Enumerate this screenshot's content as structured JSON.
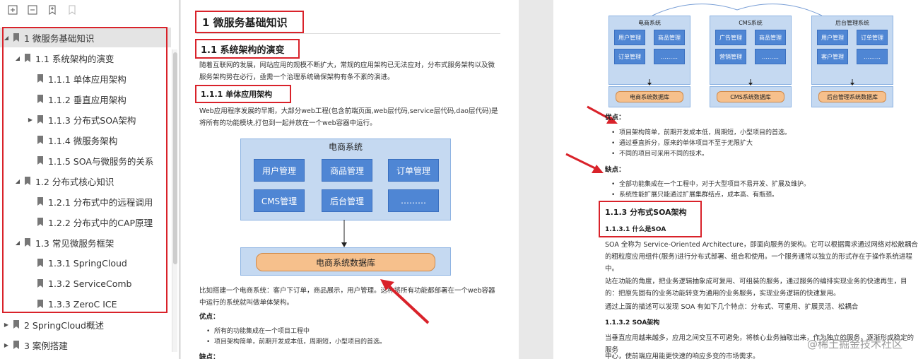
{
  "toolbar": {
    "icons": [
      "expand-all-icon",
      "collapse-all-icon",
      "add-bookmark-icon",
      "bookmark-disabled-icon"
    ]
  },
  "outline": [
    {
      "label": "1 微服务基础知识",
      "level": 0,
      "expanded": true,
      "selected": true
    },
    {
      "label": "1.1 系统架构的演变",
      "level": 1,
      "expanded": true
    },
    {
      "label": "1.1.1 单体应用架构",
      "level": 2
    },
    {
      "label": "1.1.2 垂直应用架构",
      "level": 2
    },
    {
      "label": "1.1.3 分布式SOA架构",
      "level": 2,
      "collapsed": true
    },
    {
      "label": "1.1.4 微服务架构",
      "level": 2
    },
    {
      "label": "1.1.5 SOA与微服务的关系",
      "level": 2
    },
    {
      "label": "1.2 分布式核心知识",
      "level": 1,
      "expanded": true
    },
    {
      "label": "1.2.1  分布式中的远程调用",
      "level": 2
    },
    {
      "label": "1.2.2  分布式中的CAP原理",
      "level": 2
    },
    {
      "label": "1.3 常见微服务框架",
      "level": 1,
      "expanded": true
    },
    {
      "label": "1.3.1 SpringCloud",
      "level": 2
    },
    {
      "label": "1.3.2 ServiceComb",
      "level": 2
    },
    {
      "label": "1.3.3 ZeroC ICE",
      "level": 2
    },
    {
      "label": "2 SpringCloud概述",
      "level": 0,
      "collapsed": true
    },
    {
      "label": "3 案例搭建",
      "level": 0,
      "collapsed": true
    }
  ],
  "page1": {
    "h1": "1 微服务基础知识",
    "h2": "1.1 系统架构的演变",
    "p1": "随着互联网的发展，网站应用的规模不断扩大，常规的应用架构已无法应对，分布式服务架构以及微服务架构势在必行，亟需一个治理系统确保架构有条不紊的演进。",
    "h3": "1.1.1 单体应用架构",
    "p2": "Web应用程序发展的早期，大部分web工程(包含前端页面,web层代码,service层代码,dao层代码)是将所有的功能模块,打包到一起并放在一个web容器中运行。",
    "diagram": {
      "title": "电商系统",
      "cells": [
        "用户管理",
        "商品管理",
        "订单管理",
        "CMS管理",
        "后台管理",
        "………"
      ],
      "db": "电商系统数据库"
    },
    "p3": "比如搭建一个电商系统：客户下订单，商品展示，用户管理。这种将所有功能都部署在一个web容器中运行的系统就叫做单体架构。",
    "pros_label": "优点：",
    "pros": [
      "所有的功能集成在一个项目工程中",
      "项目架构简单，前期开发成本低，周期短，小型项目的首选。"
    ],
    "cons_label": "缺点："
  },
  "page2": {
    "systems": [
      {
        "title": "电商系统",
        "cells": [
          "用户管理",
          "商品管理",
          "订单管理",
          "………"
        ],
        "db": "电商系统数据库"
      },
      {
        "title": "CMS系统",
        "cells": [
          "广告管理",
          "商品管理",
          "营销管理",
          "………"
        ],
        "db": "CMS系统数据库"
      },
      {
        "title": "后台管理系统",
        "cells": [
          "用户管理",
          "订单管理",
          "客户管理",
          "………"
        ],
        "db": "后台管理系统数据库"
      }
    ],
    "pros_label": "优点：",
    "pros": [
      "项目架构简单，前期开发成本低，周期短，小型项目的首选。",
      "通过垂直拆分，原来的单体项目不至于无限扩大",
      "不同的项目可采用不同的技术。"
    ],
    "cons_label": "缺点：",
    "cons": [
      "全部功能集成在一个工程中，对于大型项目不易开发、扩展及维护。",
      "系统性能扩展只能通过扩展集群结点，成本高、有瓶颈。"
    ],
    "h3": "1.1.3 分布式SOA架构",
    "h4a": "1.1.3.1 什么是SOA",
    "pa": "SOA 全称为 Service-Oriented Architecture，即面向服务的架构。它可以根据需求通过网络对松散耦合的粗粒度应用组件(服务)进行分布式部署、组合和使用。一个服务通常以独立的形式存在于操作系统进程中。",
    "pb": "站在功能的角度，把业务逻辑抽象成可复用、可组装的服务，通过服务的编排实现业务的快速再生，目的：把原先固有的业务功能转变为通用的业务服务，实现业务逻辑的快速复用。",
    "pc": "通过上面的描述可以发现 SOA 有如下几个特点：分布式、可重用、扩展灵活、松耦合",
    "h4b": "1.1.3.2 SOA架构",
    "pd": "当垂直应用越来越多，应用之间交互不可避免，将核心业务抽取出来，作为独立的服务，逐渐形成稳定的服务",
    "pe": "中心，使前端应用能更快速的响应多变的市场需求。"
  },
  "watermark": "@稀土掘金技术社区"
}
